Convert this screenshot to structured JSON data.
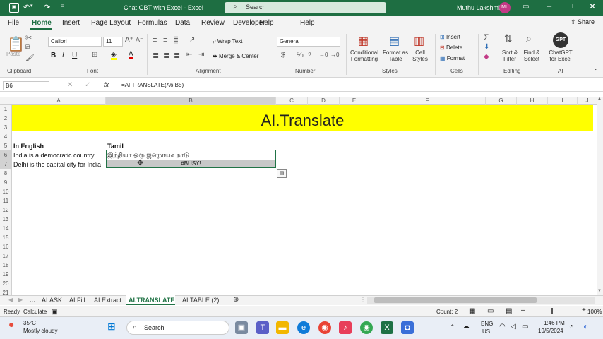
{
  "titlebar": {
    "title": "Chat GBT with Excel  -  Excel",
    "search": "Search",
    "user": "Muthu Lakshmi",
    "initials": "ML",
    "autosave_icon": "save-icon",
    "undo_icon": "undo-icon",
    "redo_icon": "redo-icon"
  },
  "menu": [
    "File",
    "Home",
    "Insert",
    "Page Layout",
    "Formulas",
    "Data",
    "Review",
    "Developer",
    "Help"
  ],
  "share": "Share",
  "ribbon": {
    "paste": "Paste",
    "font_name": "Calibri",
    "font_size": "11",
    "wrap_text": "Wrap Text",
    "merge_center": "Merge & Center",
    "number_format": "General",
    "conditional": "Conditional Formatting",
    "format_table": "Format as Table",
    "cell_styles": "Cell Styles",
    "insert": "Insert",
    "delete": "Delete",
    "format": "Format",
    "sort_filter": "Sort & Filter",
    "find_select": "Find & Select",
    "chatgpt": "ChatGPT for Excel",
    "gpt_badge": "GPT",
    "groups": [
      "Clipboard",
      "Font",
      "Alignment",
      "Number",
      "Styles",
      "Cells",
      "Editing",
      "AI"
    ]
  },
  "formula_bar": {
    "name_box": "B6",
    "formula": "=AI.TRANSLATE(A6,B5)"
  },
  "columns": [
    "A",
    "B",
    "C",
    "D",
    "E",
    "F",
    "G",
    "H",
    "I",
    "J"
  ],
  "rows": [
    "1",
    "2",
    "3",
    "4",
    "5",
    "6",
    "7",
    "8",
    "9",
    "10",
    "11",
    "12",
    "13",
    "14",
    "15",
    "16",
    "17",
    "18",
    "19",
    "20",
    "21"
  ],
  "cells": {
    "title": "AI.Translate",
    "a5": "In English",
    "b5": "Tamil",
    "a6": "India is a democratic country",
    "b6": "இந்தியா ஒரு ஜனநாயக நாடு",
    "a7": "Delhi is the capital city for India",
    "b7": "#BUSY!"
  },
  "sheet_tabs": [
    "AI.ASK",
    "AI.Fill",
    "AI.Extract",
    "AI.TRANSLATE",
    "AI.TABLE (2)"
  ],
  "active_tab": "AI.TRANSLATE",
  "status": {
    "ready": "Ready",
    "calculate": "Calculate",
    "count": "Count: 2",
    "zoom": "100%"
  },
  "taskbar": {
    "temp": "35°C",
    "weather": "Mostly cloudy",
    "search": "Search",
    "lang1": "ENG",
    "lang2": "US",
    "time": "1:46 PM",
    "date": "19/5/2024"
  }
}
